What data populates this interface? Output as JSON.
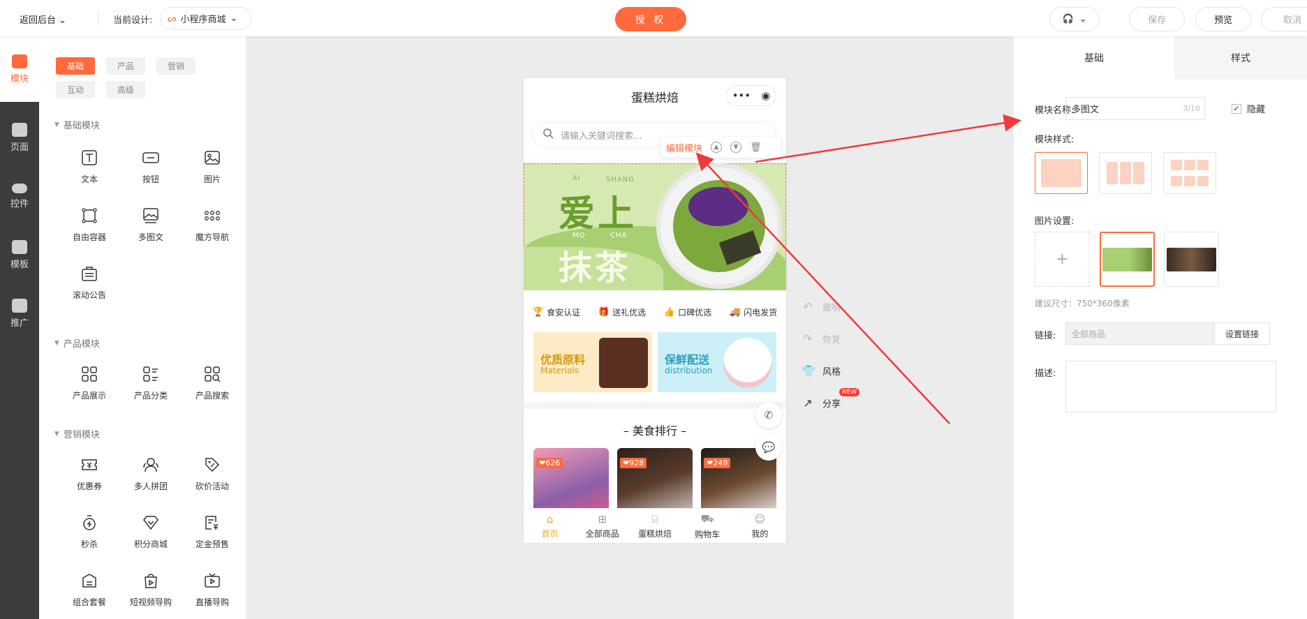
{
  "topbar": {
    "back_label": "返回后台",
    "current_design_label": "当前设计:",
    "design_name": "小程序商城",
    "auth_label": "授 权",
    "save_label": "保存",
    "preview_label": "预览",
    "cancel_label": "取消"
  },
  "rail": [
    {
      "label": "模块",
      "icon": "module-icon"
    },
    {
      "label": "页面",
      "icon": "page-icon"
    },
    {
      "label": "控件",
      "icon": "toggle-icon"
    },
    {
      "label": "模板",
      "icon": "template-icon"
    },
    {
      "label": "推广",
      "icon": "megaphone-icon"
    }
  ],
  "module_tabs": [
    "基础",
    "产品",
    "营销",
    "互动",
    "高级"
  ],
  "groups": {
    "basic": {
      "title": "基础模块",
      "items": [
        "文本",
        "按钮",
        "图片",
        "自由容器",
        "多图文",
        "魔方导航",
        "滚动公告"
      ]
    },
    "product": {
      "title": "产品模块",
      "items": [
        "产品展示",
        "产品分类",
        "产品搜索"
      ]
    },
    "marketing": {
      "title": "营销模块",
      "items": [
        "优惠券",
        "多人拼团",
        "砍价活动",
        "秒杀",
        "积分商城",
        "定金预售",
        "组合套餐",
        "短视频导购",
        "直播导购"
      ]
    }
  },
  "phone": {
    "title": "蛋糕烘焙",
    "search_placeholder": "请输入关键词搜索...",
    "banner": {
      "line1": "爱上",
      "line2": "抹茶",
      "ai": "AI",
      "shang": "SHANG",
      "mo": "MO",
      "cha": "CHA"
    },
    "features": [
      "食安认证",
      "送礼优选",
      "口碑优选",
      "闪电发货"
    ],
    "promos": [
      {
        "title": "优质原料",
        "sub": "Materials"
      },
      {
        "title": "保鲜配送",
        "sub": "distribution"
      }
    ],
    "rank_title": "美食排行",
    "rank_likes": [
      "626",
      "928",
      "249"
    ],
    "tabbar": [
      "首页",
      "全部商品",
      "蛋糕烘焙",
      "购物车",
      "我的"
    ]
  },
  "editbar": {
    "label": "编辑模块"
  },
  "side_actions": {
    "undo": "撤销",
    "redo": "恢复",
    "style": "风格",
    "share": "分享",
    "new_badge": "NEW"
  },
  "rpanel": {
    "tabs": [
      "基础",
      "样式"
    ],
    "name_label": "模块名称:",
    "name_value": "多图文",
    "name_count": "3/10",
    "hide_label": "隐藏",
    "hide_checked": true,
    "style_label": "模块样式:",
    "image_label": "图片设置:",
    "image_hint": "建议尺寸：750*360像素",
    "link_label": "链接:",
    "link_value": "全部商品",
    "link_button": "设置链接",
    "desc_label": "描述:"
  },
  "colors": {
    "accent": "#ff6a3d",
    "annotation": "#f03a3a"
  }
}
